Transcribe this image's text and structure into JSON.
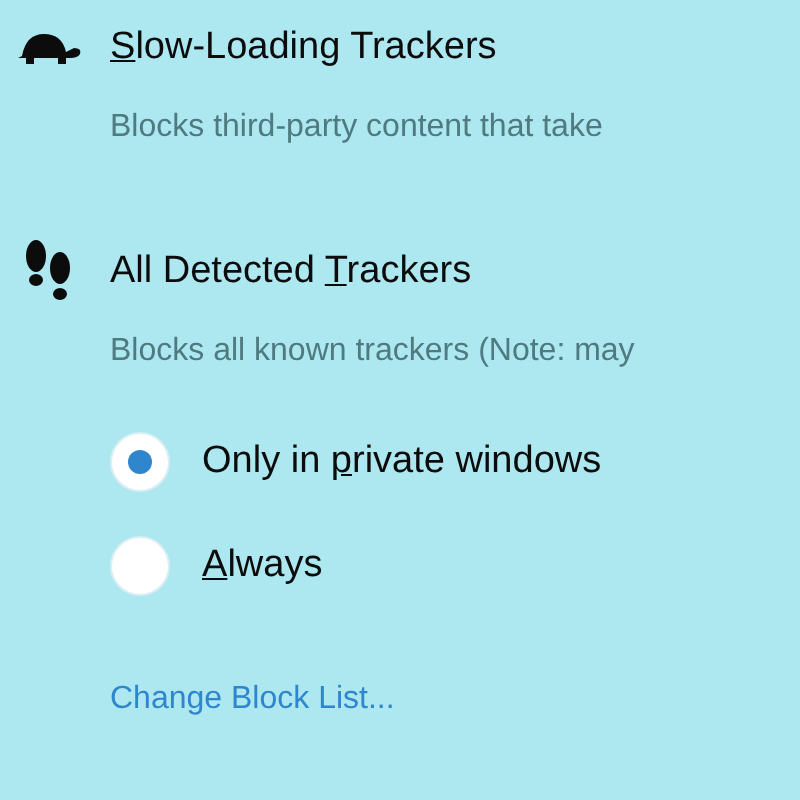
{
  "sections": [
    {
      "kind": "turtle",
      "title": [
        {
          "text": "S",
          "underlined": true
        },
        {
          "text": "low-Loading Trackers",
          "underlined": false
        }
      ],
      "description": "Blocks third-party content that take"
    },
    {
      "kind": "footprints",
      "title": [
        {
          "text": "All Detected ",
          "underlined": false
        },
        {
          "text": "T",
          "underlined": true
        },
        {
          "text": "rackers",
          "underlined": false
        }
      ],
      "description": "Blocks all known trackers (Note: may",
      "options": [
        {
          "label": [
            {
              "text": "Only in ",
              "underlined": false
            },
            {
              "text": "p",
              "underlined": true
            },
            {
              "text": "rivate windows",
              "underlined": false
            }
          ],
          "selected": true
        },
        {
          "label": [
            {
              "text": "A",
              "underlined": true
            },
            {
              "text": "lways",
              "underlined": false
            }
          ],
          "selected": false
        }
      ]
    }
  ],
  "link": "Change Block List..."
}
